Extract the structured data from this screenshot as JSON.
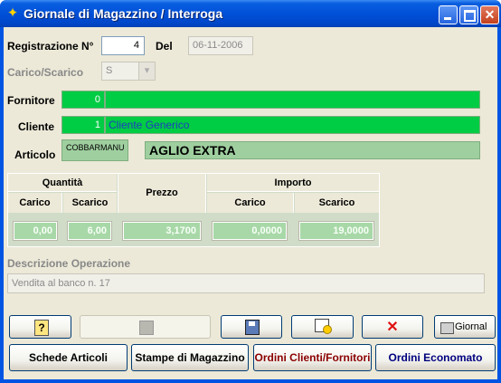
{
  "window": {
    "title": "Giornale di Magazzino / Interroga",
    "icon": "warehouse-icon"
  },
  "form": {
    "registrazione_label": "Registrazione N°",
    "registrazione_value": "4",
    "del_label": "Del",
    "del_value": "06-11-2006",
    "carico_label": "Carico/Scarico",
    "carico_value": "S",
    "fornitore_label": "Fornitore",
    "fornitore_code": "0",
    "fornitore_name": "",
    "cliente_label": "Cliente",
    "cliente_code": "1",
    "cliente_name": "Cliente Generico",
    "articolo_label": "Articolo",
    "articolo_code": "COBBARMANU",
    "articolo_name": "AGLIO EXTRA",
    "descrizione_label": "Descrizione Operazione",
    "descrizione_value": "Vendita al banco n.   17"
  },
  "grid": {
    "quantita": "Quantità",
    "prezzo": "Prezzo",
    "importo": "Importo",
    "carico": "Carico",
    "scarico": "Scarico",
    "q_carico": "0,00",
    "q_scarico": "6,00",
    "prezzo_value": "3,1700",
    "i_carico": "0,0000",
    "i_scarico": "19,0000"
  },
  "toolbar": {
    "help_icon": "help-icon",
    "save_icon": "save-icon",
    "edit_icon": "edit-disk-icon",
    "new_icon": "new-record-icon",
    "delete_icon": "delete-icon",
    "giornale_label": "Giornal",
    "schede_label": "Schede Articoli",
    "stampe_label": "Stampe di Magazzino",
    "ordini_cf_label": "Ordini Clienti/Fornitori",
    "ordini_eco_label": "Ordini Economato"
  },
  "colors": {
    "green": "#00cc44",
    "ordini_cf": "#8b0000",
    "ordini_eco": "#00007f",
    "cliente_text": "#1f3fbf"
  }
}
